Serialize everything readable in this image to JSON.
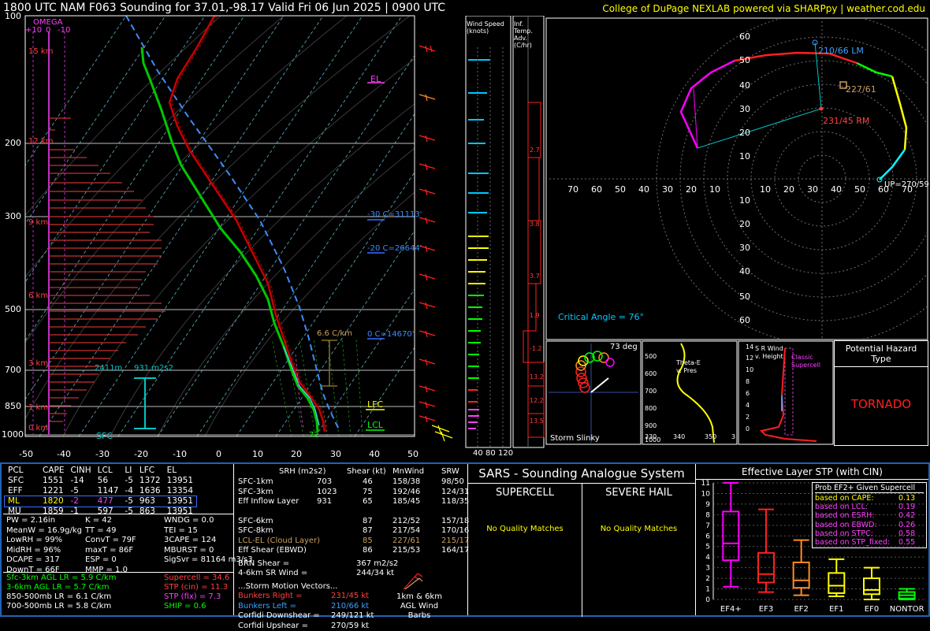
{
  "header": {
    "title": "1800 UTC NAM F063 Sounding for 37.01,-98.17 Valid  Fri 06 Jun 2025 | 0900 UTC",
    "credit": "College of DuPage NEXLAB powered via SHARPpy | weather.cod.edu"
  },
  "skewt": {
    "pressure_ticks": [
      "100",
      "200",
      "300",
      "500",
      "700",
      "850",
      "1000"
    ],
    "temp_ticks": [
      "-50",
      "-40",
      "-30",
      "-20",
      "-10",
      "0",
      "10",
      "20",
      "30",
      "40",
      "50"
    ],
    "omega_label": "OMEGA",
    "omega_scale": [
      "+10",
      "0",
      "-10"
    ],
    "height_labels": [
      "15 km",
      "12 km",
      "9 km",
      "6 km",
      "3 km",
      "1 km",
      "0 km"
    ],
    "el_label": "EL",
    "lfc_label": "LFC",
    "lcl_label": "LCL",
    "sfc_label": "SFC",
    "lapse_label": "6.6 C/km",
    "freeze_labels": [
      "-30 C=31113'",
      "-20 C=26644'",
      "0 C=14670'"
    ],
    "srh_depth_label": "2411m",
    "srh_value_label": "931 m2s2",
    "sfc_temp_label": "72"
  },
  "wind_speed_panel": {
    "title": "Wind Speed (knots)",
    "ticks": [
      "40",
      "80",
      "120"
    ]
  },
  "temp_adv_panel": {
    "title": "Inf. Temp. Adv. (C/hr)",
    "values": [
      "2.7",
      "3.8",
      "3.7",
      "1.9",
      "-1.2",
      "13.2",
      "12.2",
      "13.5"
    ]
  },
  "hodograph": {
    "rings": [
      "10",
      "20",
      "30",
      "40",
      "50",
      "60"
    ],
    "x_ticks": [
      "70",
      "60",
      "50",
      "40",
      "30",
      "20",
      "10",
      "10",
      "20",
      "30",
      "40",
      "50",
      "60",
      "70"
    ],
    "labels": {
      "lm": "210/66 LM",
      "rm": "231/45 RM",
      "mean": "227/61",
      "up": "UP=270/59"
    },
    "critical_angle": "Critical Angle = 76°"
  },
  "slinky": {
    "title": "Storm Slinky",
    "angle": "73 deg"
  },
  "theta_panel": {
    "title": "Theta-E v. Pres",
    "y_ticks": [
      "500",
      "600",
      "700",
      "800",
      "900",
      "1000"
    ],
    "x_ticks": [
      "330",
      "340",
      "350",
      "3"
    ]
  },
  "srwind_panel": {
    "title": "S R Wind v. Height",
    "classic": "Classic Supercell",
    "y_ticks": [
      "14",
      "12",
      "10",
      "8",
      "6",
      "4",
      "2",
      "0"
    ]
  },
  "hazard": {
    "title": "Potential Hazard Type",
    "value": "TORNADO"
  },
  "parcels": {
    "headers": [
      "PCL",
      "CAPE",
      "CINH",
      "LCL",
      "LI",
      "LFC",
      "EL"
    ],
    "rows": [
      [
        "SFC",
        "1551",
        "-14",
        "56",
        "-5",
        "1372",
        "13951"
      ],
      [
        "EFF",
        "1221",
        "-5",
        "1147",
        "-4",
        "1636",
        "13354"
      ],
      [
        "ML",
        "1820",
        "-2",
        "477",
        "-5",
        "963",
        "13951"
      ],
      [
        "MU",
        "1859",
        "-1",
        "597",
        "-5",
        "863",
        "13951"
      ]
    ]
  },
  "indices": {
    "col1": [
      "PW = 2.16in",
      "MeanW = 16.9g/kg",
      "LowRH = 99%",
      "MidRH = 96%",
      "DCAPE = 317",
      "DownT = 66F"
    ],
    "col2": [
      "K = 42",
      "TT = 49",
      "ConvT = 79F",
      "maxT = 86F",
      "ESP = 0",
      "MMP = 1.0"
    ],
    "col3": [
      "WNDG = 0.0",
      "TEI = 15",
      "3CAPE = 124",
      "MBURST = 0",
      "",
      ""
    ],
    "sigsvr": "SigSvr = 81164 m3/s3"
  },
  "lapse_rates": [
    {
      "text": "Sfc-3km AGL LR = 5.9 C/km",
      "color": "#00ff00"
    },
    {
      "text": "3-6km AGL LR = 5.7 C/km",
      "color": "#00ff00"
    },
    {
      "text": "850-500mb LR = 6.1 C/km",
      "color": "#ffffff"
    },
    {
      "text": "700-500mb LR = 5.8 C/km",
      "color": "#ffffff"
    }
  ],
  "composites": [
    {
      "text": "Supercell = 34.6",
      "color": "#ff4040"
    },
    {
      "text": "STP (cin) = 11.3",
      "color": "#ff4040"
    },
    {
      "text": "STP (fix) = 7.3",
      "color": "#ff40ff"
    },
    {
      "text": "SHIP = 0.6",
      "color": "#00ff00"
    }
  ],
  "kinematics": {
    "headers": [
      "SRH (m2s2)",
      "Shear (kt)",
      "MnWind",
      "SRW"
    ],
    "rows": [
      {
        "label": "SFC-1km",
        "srh": "703",
        "shear": "46",
        "mn": "158/38",
        "srw": "98/50",
        "color": "#ffffff"
      },
      {
        "label": "SFC-3km",
        "srh": "1023",
        "shear": "75",
        "mn": "192/46",
        "srw": "124/31",
        "color": "#ffffff"
      },
      {
        "label": "Eff Inflow Layer",
        "srh": "931",
        "shear": "65",
        "mn": "185/45",
        "srw": "118/35",
        "color": "#ffffff"
      },
      {
        "label": "SFC-6km",
        "srh": "",
        "shear": "87",
        "mn": "212/52",
        "srw": "157/18",
        "color": "#ffffff"
      },
      {
        "label": "SFC-8km",
        "srh": "",
        "shear": "87",
        "mn": "217/54",
        "srw": "170/16",
        "color": "#ffffff"
      },
      {
        "label": "LCL-EL (Cloud Layer)",
        "srh": "",
        "shear": "85",
        "mn": "227/61",
        "srw": "215/17",
        "color": "#c8a060"
      },
      {
        "label": "Eff Shear (EBWD)",
        "srh": "",
        "shear": "86",
        "mn": "215/53",
        "srw": "164/17",
        "color": "#ffffff"
      }
    ],
    "brn": {
      "label": "BRN Shear =",
      "value": "367 m2/s2"
    },
    "srwind": {
      "label": "4-6km SR Wind =",
      "value": "244/34 kt"
    },
    "storm_motion_title": "...Storm Motion Vectors...",
    "motions": [
      {
        "label": "Bunkers Right =",
        "value": "231/45 kt",
        "color": "#ff4040"
      },
      {
        "label": "Bunkers Left =",
        "value": "210/66 kt",
        "color": "#3ca0ff"
      },
      {
        "label": "Corfidi Downshear =",
        "value": "249/121 kt",
        "color": "#ffffff"
      },
      {
        "label": "Corfidi Upshear =",
        "value": "270/59 kt",
        "color": "#ffffff"
      }
    ],
    "barbs_label": "1km & 6km AGL Wind Barbs"
  },
  "sars": {
    "title": "SARS - Sounding Analogue System",
    "supercell": "SUPERCELL",
    "hail": "SEVERE HAIL",
    "no_match": "No Quality Matches"
  },
  "stp_panel": {
    "title": "Effective Layer STP (with CIN)",
    "y_ticks": [
      "11",
      "10",
      "9",
      "8",
      "7",
      "6",
      "5",
      "4",
      "3",
      "2",
      "1",
      "0"
    ],
    "categories": [
      "EF4+",
      "EF3",
      "EF2",
      "EF1",
      "EF0",
      "NONTOR"
    ],
    "prob_title": "Prob EF2+ Given Supercell",
    "probs": [
      {
        "label": "based on CAPE:",
        "value": "0.13"
      },
      {
        "label": "based on LCL:",
        "value": "0.19"
      },
      {
        "label": "based on ESRH:",
        "value": "0.42"
      },
      {
        "label": "based on EBWD:",
        "value": "0.26"
      },
      {
        "label": "based on STPC:",
        "value": "0.58"
      },
      {
        "label": "based on STP_fixed:",
        "value": "0.55"
      }
    ]
  },
  "chart_data": {
    "type": "box",
    "title": "Effective Layer STP (with CIN)",
    "categories": [
      "EF4+",
      "EF3",
      "EF2",
      "EF1",
      "EF0",
      "NONTOR"
    ],
    "ylim": [
      0,
      11
    ],
    "boxes": [
      {
        "name": "EF4+",
        "whisker_low": 1.2,
        "q1": 3.7,
        "median": 5.3,
        "q3": 8.3,
        "whisker_high": 11.0,
        "color": "#ff00ff"
      },
      {
        "name": "EF3",
        "whisker_low": 0.7,
        "q1": 1.6,
        "median": 2.4,
        "q3": 4.4,
        "whisker_high": 8.5,
        "color": "#ff2020"
      },
      {
        "name": "EF2",
        "whisker_low": 0.4,
        "q1": 1.1,
        "median": 1.8,
        "q3": 3.5,
        "whisker_high": 5.6,
        "color": "#ff8c1e"
      },
      {
        "name": "EF1",
        "whisker_low": 0.3,
        "q1": 0.6,
        "median": 1.3,
        "q3": 2.5,
        "whisker_high": 3.8,
        "color": "#ffff00"
      },
      {
        "name": "EF0",
        "whisker_low": 0.0,
        "q1": 0.5,
        "median": 0.9,
        "q3": 2.0,
        "whisker_high": 3.0,
        "color": "#ffff00"
      },
      {
        "name": "NONTOR",
        "whisker_low": 0.0,
        "q1": 0.1,
        "median": 0.4,
        "q3": 0.7,
        "whisker_high": 1.0,
        "color": "#00ff00"
      }
    ]
  }
}
